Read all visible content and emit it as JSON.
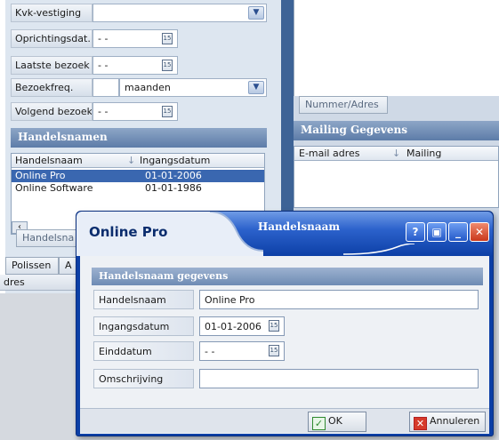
{
  "background": {
    "fields": [
      {
        "label": "Kvk-vestiging",
        "value": ""
      },
      {
        "label": "Oprichtingsdat.",
        "value": "- -"
      },
      {
        "label": "Laatste bezoek",
        "value": "- -"
      },
      {
        "label": "Bezoekfreq.",
        "value": "maanden"
      },
      {
        "label": "Volgend bezoek",
        "value": "- -"
      }
    ],
    "handelsnamen": {
      "title": "Handelsnamen",
      "columns": [
        "Handelsnaam",
        "Ingangsdatum"
      ],
      "rows": [
        {
          "name": "Online Pro",
          "date": "01-01-2006"
        },
        {
          "name": "Online Software",
          "date": "01-01-1986"
        }
      ],
      "tab_partial": "Handelsna"
    },
    "bottom_tab": "Polissen",
    "bottom_tab_b": "A",
    "bottom_label": "dres",
    "right": {
      "tab": "Nummer/Adres",
      "mailing_title": "Mailing Gegevens",
      "columns": [
        "E-mail adres",
        "Mailing"
      ]
    }
  },
  "dialog": {
    "left_title": "Online Pro",
    "center_title": "Handelsnaam",
    "group_title": "Handelsnaam gegevens",
    "fields": [
      {
        "label": "Handelsnaam",
        "value": "Online Pro"
      },
      {
        "label": "Ingangsdatum",
        "value": "01-01-2006"
      },
      {
        "label": "Einddatum",
        "value": "- -"
      },
      {
        "label": "Omschrijving",
        "value": ""
      }
    ],
    "buttons": {
      "ok": "OK",
      "cancel": "Annuleren"
    }
  }
}
